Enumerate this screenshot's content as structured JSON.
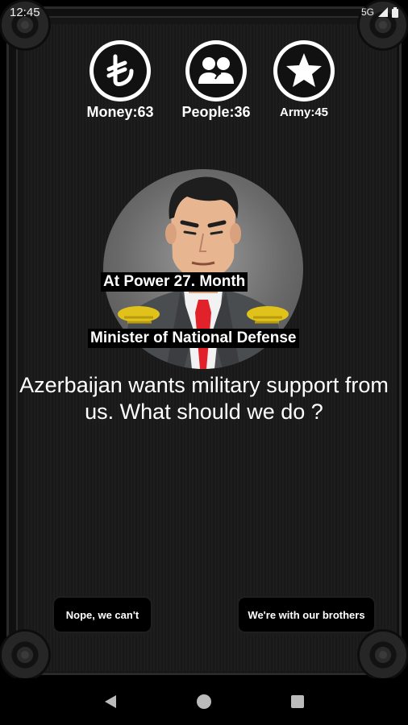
{
  "status": {
    "time": "12:45",
    "network": "5G"
  },
  "stats": [
    {
      "name": "Money",
      "label": "Money:63",
      "value": 63,
      "icon": "lira-icon"
    },
    {
      "name": "People",
      "label": "People:36",
      "value": 36,
      "icon": "people-icon"
    },
    {
      "name": "Army",
      "label": "Army:45",
      "value": 45,
      "icon": "star-icon"
    }
  ],
  "character": {
    "at_power": "At Power 27. Month",
    "role": "Minister of National Defense"
  },
  "question": "Azerbaijan wants military support from us. What should we do ?",
  "choices": {
    "left": "Nope, we can't",
    "right": "We're with our brothers"
  },
  "colors": {
    "background": "#1b1b1b",
    "text": "#ffffff",
    "button": "#000000",
    "tie": "#e2222a",
    "epaulette": "#e0c21a"
  }
}
